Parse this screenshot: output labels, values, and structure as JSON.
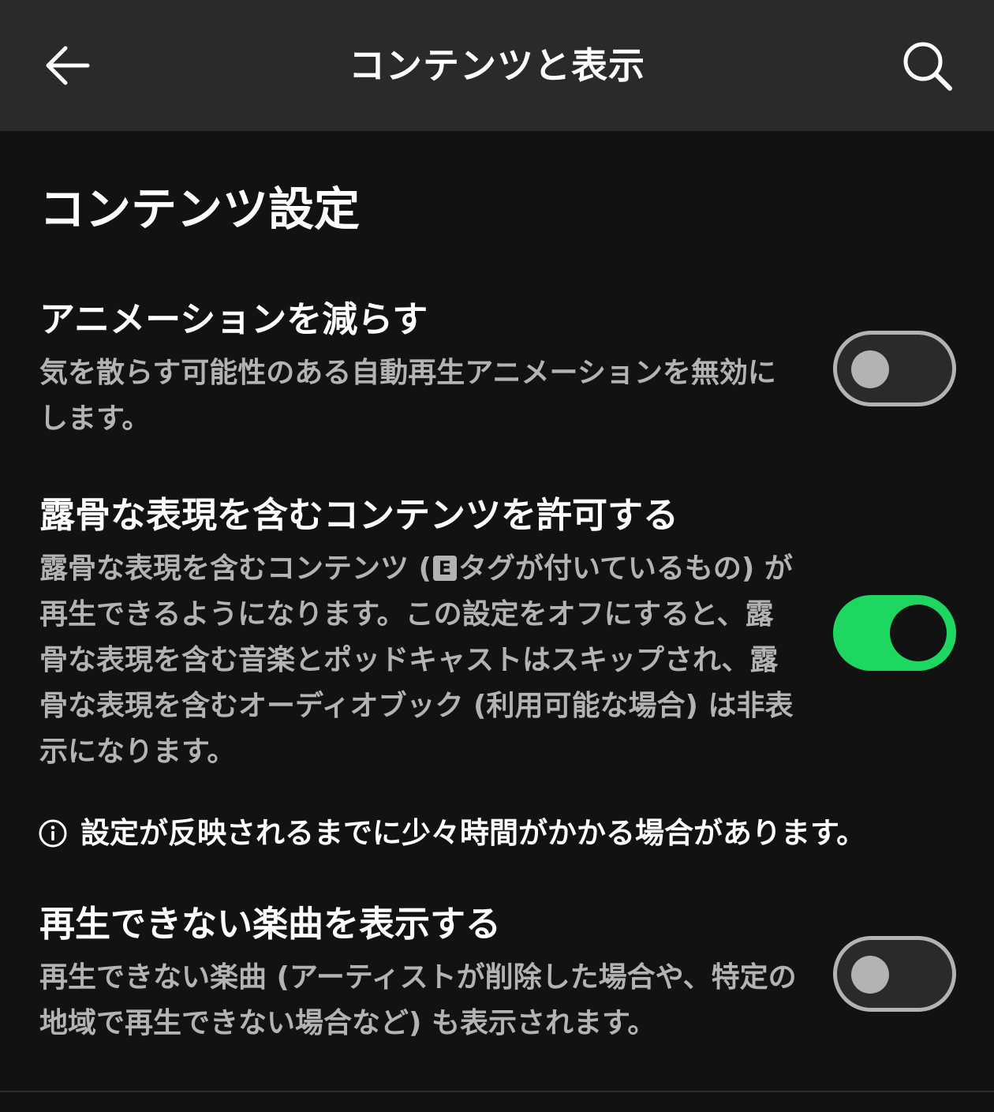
{
  "header": {
    "title": "コンテンツと表示",
    "back_icon": "arrow-left-icon",
    "search_icon": "search-icon"
  },
  "section": {
    "title": "コンテンツ設定"
  },
  "settings": [
    {
      "title": "アニメーションを減らす",
      "description": "気を散らす可能性のある自動再生アニメーションを無効にします。",
      "enabled": false
    },
    {
      "title": "露骨な表現を含むコンテンツを許可する",
      "description_part1": "露骨な表現を含むコンテンツ (",
      "badge": "E",
      "description_part2": "タグが付いているもの) が再生できるようになります。この設定をオフにすると、露骨な表現を含む音楽とポッドキャストはスキップされ、露骨な表現を含むオーディオブック (利用可能な場合) は非表示になります。",
      "enabled": true
    },
    {
      "title": "再生できない楽曲を表示する",
      "description": "再生できない楽曲 (アーティストが削除した場合や、特定の地域で再生できない場合など) も表示されます。",
      "enabled": false
    }
  ],
  "note": {
    "icon": "info-icon",
    "text": "設定が反映されるまでに少々時間がかかる場合があります。"
  },
  "colors": {
    "background": "#121212",
    "header": "#2a2a2a",
    "accent": "#1ed760",
    "secondary_text": "#b3b3b3"
  }
}
